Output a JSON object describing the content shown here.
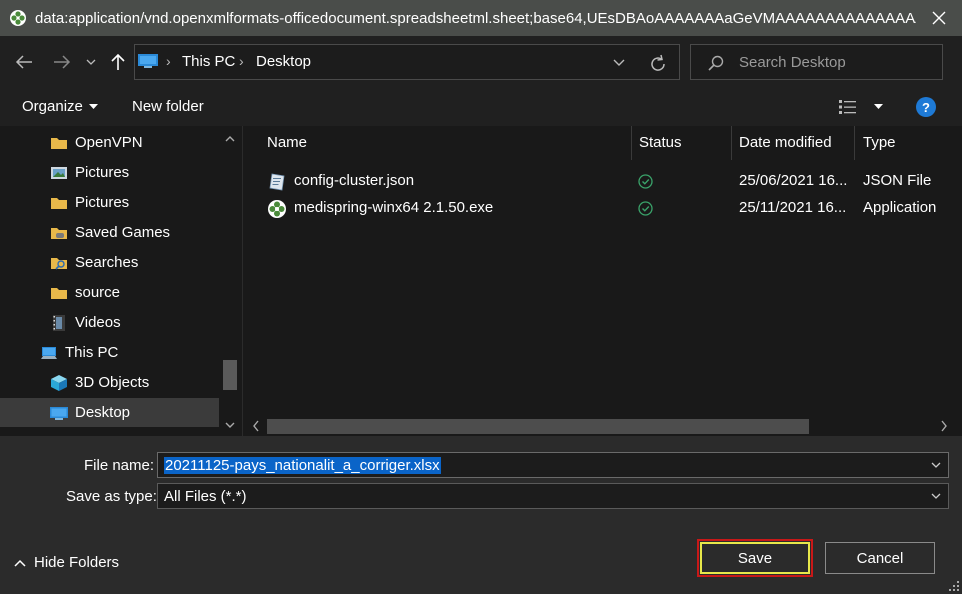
{
  "titlebar": {
    "title": "data:application/vnd.openxmlformats-officedocument.spreadsheetml.sheet;base64,UEsDBAoAAAAAAAaGeVMAAAAAAAAAAAAAAA...",
    "app_icon": "app-flower-icon",
    "close_icon": "close-icon"
  },
  "address": {
    "crumbs": [
      "This PC",
      "Desktop"
    ],
    "search_placeholder": "Search Desktop"
  },
  "toolbar": {
    "organize_label": "Organize",
    "new_folder_label": "New folder",
    "help_label": "?"
  },
  "nav": {
    "items": [
      {
        "label": "OpenVPN",
        "icon": "folder-icon"
      },
      {
        "label": "Pictures",
        "icon": "pictures-icon"
      },
      {
        "label": "Pictures",
        "icon": "folder-icon"
      },
      {
        "label": "Saved Games",
        "icon": "saved-games-icon"
      },
      {
        "label": "Searches",
        "icon": "searches-icon"
      },
      {
        "label": "source",
        "icon": "folder-icon"
      },
      {
        "label": "Videos",
        "icon": "videos-icon"
      },
      {
        "label": "This PC",
        "icon": "computer-icon"
      },
      {
        "label": "3D Objects",
        "icon": "3d-objects-icon"
      },
      {
        "label": "Desktop",
        "icon": "desktop-icon"
      }
    ]
  },
  "files": {
    "columns": [
      "Name",
      "Status",
      "Date modified",
      "Type"
    ],
    "rows": [
      {
        "name": "config-cluster.json",
        "status": "synced",
        "date": "25/06/2021 16...",
        "type": "JSON File",
        "icon": "json-file-icon"
      },
      {
        "name": "medispring-winx64 2.1.50.exe",
        "status": "synced",
        "date": "25/11/2021 16...",
        "type": "Application",
        "icon": "exe-file-icon"
      }
    ]
  },
  "form": {
    "file_name_label": "File name:",
    "file_name_value": "20211125-pays_nationalit_a_corriger.xlsx",
    "save_as_type_label": "Save as type:",
    "save_as_type_value": "All Files (*.*)"
  },
  "footer": {
    "hide_folders_label": "Hide Folders",
    "save_label": "Save",
    "cancel_label": "Cancel"
  },
  "colors": {
    "selection": "#0a64c8",
    "save_highlight_inner": "#e8e84a",
    "save_highlight_outer": "#c81818",
    "status_ok": "#3aa36a"
  }
}
